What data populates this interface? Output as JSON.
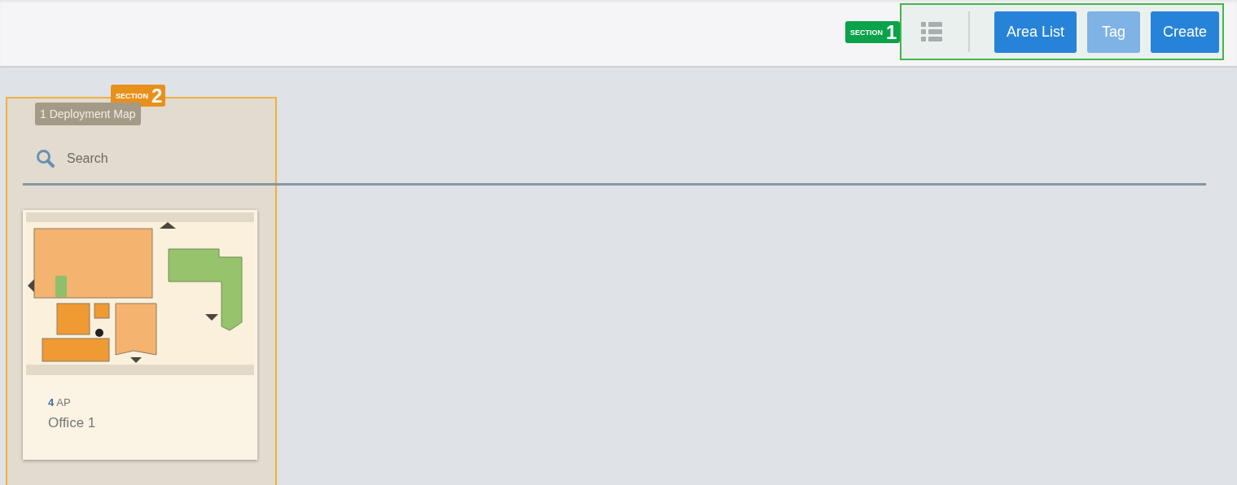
{
  "toolbar": {
    "buttons": [
      {
        "label": "Area List",
        "disabled": false
      },
      {
        "label": "Tag",
        "disabled": true
      },
      {
        "label": "Create",
        "disabled": false
      }
    ]
  },
  "map_count_badge": "1 Deployment Map",
  "search": {
    "placeholder": "Search"
  },
  "maps": [
    {
      "ap_count": "4",
      "ap_unit": "AP",
      "name": "Office 1",
      "kind": "picture"
    }
  ],
  "section_labels": [
    {
      "label": "SECTION",
      "number": "1",
      "color": "#0aa24a"
    },
    {
      "label": "SECTION",
      "number": "2",
      "color": "#e8901c"
    }
  ]
}
